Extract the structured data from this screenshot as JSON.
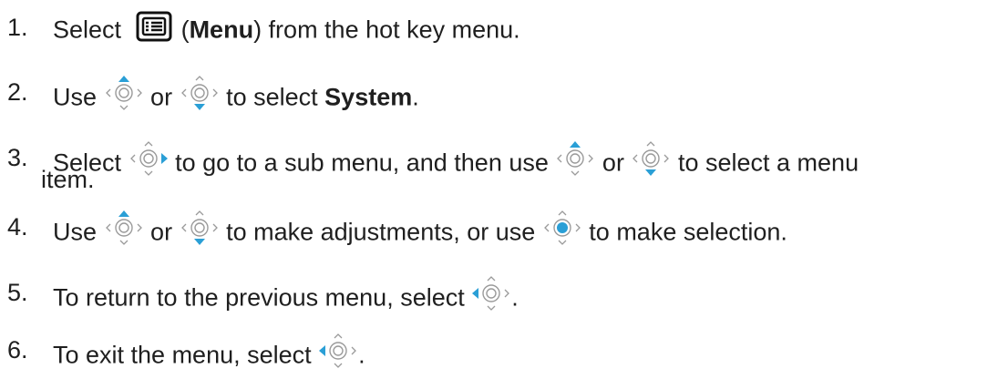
{
  "icons": {
    "menu": "menu-list-icon",
    "up": "dial-up-icon",
    "down": "dial-down-icon",
    "right": "dial-right-icon",
    "left": "dial-left-icon",
    "center": "dial-center-icon"
  },
  "colors": {
    "accent": "#2a9fd6",
    "icon_gray": "#9a9a9a",
    "text": "#1f1f1f"
  },
  "steps": [
    {
      "number": "1.",
      "pre": "Select",
      "paren_open": "(",
      "bold": "Menu",
      "post": ") from the hot key menu."
    },
    {
      "number": "2.",
      "pre": "Use",
      "or": "or",
      "mid": "to select",
      "bold": "System",
      "end": "."
    },
    {
      "number": "3.",
      "pre": "Select",
      "mid": "to go to a sub menu, and then use",
      "or": "or",
      "post": "to select a menu",
      "continuation": "item."
    },
    {
      "number": "4.",
      "pre": "Use",
      "or": "or",
      "mid": "to make adjustments, or use",
      "post": "to make selection."
    },
    {
      "number": "5.",
      "pre": "To return to the previous menu, select",
      "end": "."
    },
    {
      "number": "6.",
      "pre": "To exit the menu, select",
      "end": "."
    }
  ]
}
